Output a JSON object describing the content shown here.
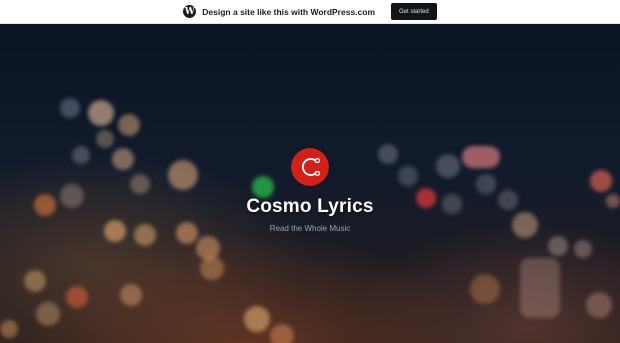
{
  "promo_bar": {
    "text": "Design a site like this with WordPress.com",
    "button_label": "Get started",
    "logo_glyph": "W"
  },
  "site": {
    "title": "Cosmo Lyrics",
    "tagline": "Read the Whole Music",
    "logo_icon": "headphone-c-icon",
    "accent_color": "#d0211b"
  }
}
